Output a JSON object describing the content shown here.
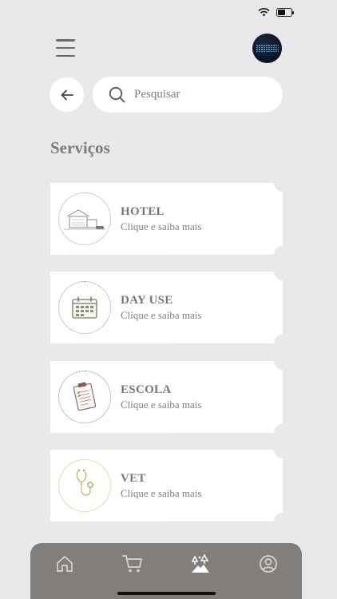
{
  "header": {
    "search_placeholder": "Pesquisar"
  },
  "section_title": "Serviços",
  "services": [
    {
      "title": "HOTEL",
      "subtitle": "Clique e saiba mais",
      "icon": "hotel-icon"
    },
    {
      "title": "DAY USE",
      "subtitle": "Clique e saiba mais",
      "icon": "calendar-icon"
    },
    {
      "title": "ESCOLA",
      "subtitle": "Clique e saiba mais",
      "icon": "clipboard-icon"
    },
    {
      "title": "VET",
      "subtitle": "Clique e saiba mais",
      "icon": "stethoscope-icon"
    }
  ],
  "tab_bar": {
    "items": [
      "home-icon",
      "cart-icon",
      "services-icon",
      "profile-icon"
    ],
    "active": "services-icon"
  },
  "colors": {
    "background": "#e9e8ea",
    "card": "#ffffff",
    "tab_bar": "#827e7b",
    "hotel_ring": "#9a9a9a",
    "dayuse_ring": "#8a9a6a",
    "escola_ring": "#8a7a8a",
    "vet_ring": "#d8d29a"
  }
}
